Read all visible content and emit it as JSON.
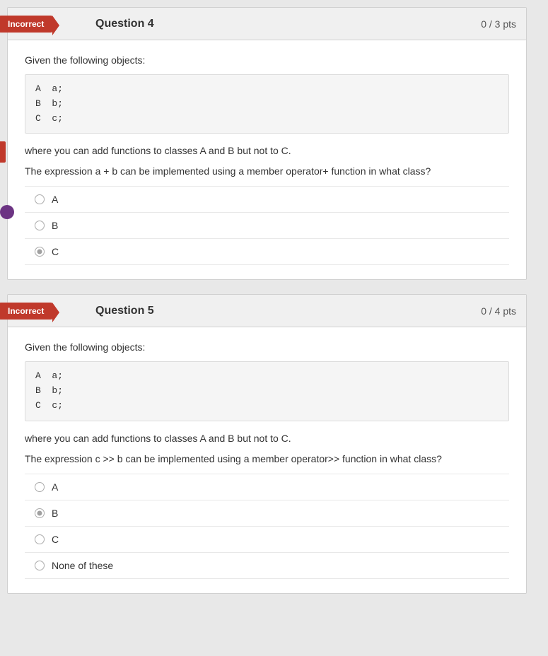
{
  "questions": [
    {
      "id": "question-4",
      "badge": "Incorrect",
      "title": "Question 4",
      "score": "0 / 3 pts",
      "intro": "Given the following objects:",
      "code": "A  a;\nB  b;\nC  c;",
      "text1": "where you can add functions to classes A and B but not to C.",
      "text2": "The expression a + b can be implemented using a member operator+ function in what class?",
      "options": [
        {
          "label": "A",
          "selected": false
        },
        {
          "label": "B",
          "selected": false
        },
        {
          "label": "C",
          "selected": true
        }
      ]
    },
    {
      "id": "question-5",
      "badge": "Incorrect",
      "title": "Question 5",
      "score": "0 / 4 pts",
      "intro": "Given the following objects:",
      "code": "A  a;\nB  b;\nC  c;",
      "text1": "where you can add functions to classes A and B but not to C.",
      "text2": "The expression c >> b can be implemented using a member operator>> function in what class?",
      "options": [
        {
          "label": "A",
          "selected": false
        },
        {
          "label": "B",
          "selected": true
        },
        {
          "label": "C",
          "selected": false
        },
        {
          "label": "None of these",
          "selected": false
        }
      ]
    }
  ]
}
